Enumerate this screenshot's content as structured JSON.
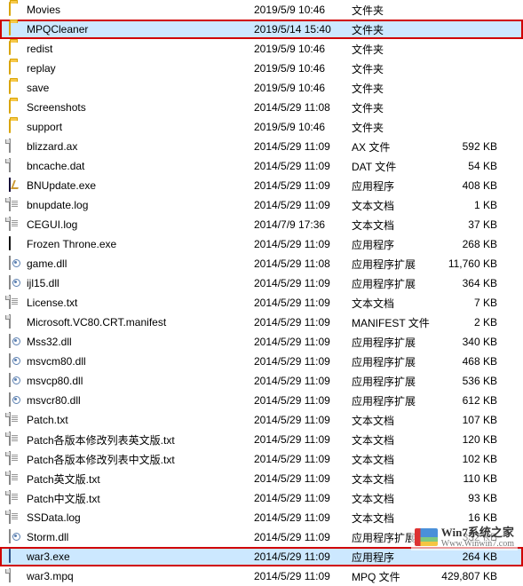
{
  "watermark": {
    "line1": "Win7系统之家",
    "line2": "Www.Winwin7.com"
  },
  "files": [
    {
      "icon": "folder",
      "name": "Movies",
      "date": "2019/5/9 10:46",
      "type": "文件夹",
      "size": ""
    },
    {
      "icon": "folder",
      "name": "MPQCleaner",
      "date": "2019/5/14 15:40",
      "type": "文件夹",
      "size": "",
      "selected": true,
      "highlight": true
    },
    {
      "icon": "folder",
      "name": "redist",
      "date": "2019/5/9 10:46",
      "type": "文件夹",
      "size": ""
    },
    {
      "icon": "folder",
      "name": "replay",
      "date": "2019/5/9 10:46",
      "type": "文件夹",
      "size": ""
    },
    {
      "icon": "folder",
      "name": "save",
      "date": "2019/5/9 10:46",
      "type": "文件夹",
      "size": ""
    },
    {
      "icon": "folder",
      "name": "Screenshots",
      "date": "2014/5/29 11:08",
      "type": "文件夹",
      "size": ""
    },
    {
      "icon": "folder",
      "name": "support",
      "date": "2019/5/9 10:46",
      "type": "文件夹",
      "size": ""
    },
    {
      "icon": "file",
      "name": "blizzard.ax",
      "date": "2014/5/29 11:09",
      "type": "AX 文件",
      "size": "592 KB"
    },
    {
      "icon": "file",
      "name": "bncache.dat",
      "date": "2014/5/29 11:09",
      "type": "DAT 文件",
      "size": "54 KB"
    },
    {
      "icon": "bnupdate",
      "name": "BNUpdate.exe",
      "date": "2014/5/29 11:09",
      "type": "应用程序",
      "size": "408 KB"
    },
    {
      "icon": "txt",
      "name": "bnupdate.log",
      "date": "2014/5/29 11:09",
      "type": "文本文档",
      "size": "1 KB"
    },
    {
      "icon": "txt",
      "name": "CEGUI.log",
      "date": "2014/7/9 17:36",
      "type": "文本文档",
      "size": "37 KB"
    },
    {
      "icon": "exe-dark",
      "name": "Frozen Throne.exe",
      "date": "2014/5/29 11:09",
      "type": "应用程序",
      "size": "268 KB"
    },
    {
      "icon": "dll",
      "name": "game.dll",
      "date": "2014/5/29 11:08",
      "type": "应用程序扩展",
      "size": "11,760 KB"
    },
    {
      "icon": "dll",
      "name": "ijl15.dll",
      "date": "2014/5/29 11:09",
      "type": "应用程序扩展",
      "size": "364 KB"
    },
    {
      "icon": "txt",
      "name": "License.txt",
      "date": "2014/5/29 11:09",
      "type": "文本文档",
      "size": "7 KB"
    },
    {
      "icon": "file",
      "name": "Microsoft.VC80.CRT.manifest",
      "date": "2014/5/29 11:09",
      "type": "MANIFEST 文件",
      "size": "2 KB"
    },
    {
      "icon": "dll",
      "name": "Mss32.dll",
      "date": "2014/5/29 11:09",
      "type": "应用程序扩展",
      "size": "340 KB"
    },
    {
      "icon": "dll",
      "name": "msvcm80.dll",
      "date": "2014/5/29 11:09",
      "type": "应用程序扩展",
      "size": "468 KB"
    },
    {
      "icon": "dll",
      "name": "msvcp80.dll",
      "date": "2014/5/29 11:09",
      "type": "应用程序扩展",
      "size": "536 KB"
    },
    {
      "icon": "dll",
      "name": "msvcr80.dll",
      "date": "2014/5/29 11:09",
      "type": "应用程序扩展",
      "size": "612 KB"
    },
    {
      "icon": "txt",
      "name": "Patch.txt",
      "date": "2014/5/29 11:09",
      "type": "文本文档",
      "size": "107 KB"
    },
    {
      "icon": "txt",
      "name": "Patch各版本修改列表英文版.txt",
      "date": "2014/5/29 11:09",
      "type": "文本文档",
      "size": "120 KB"
    },
    {
      "icon": "txt",
      "name": "Patch各版本修改列表中文版.txt",
      "date": "2014/5/29 11:09",
      "type": "文本文档",
      "size": "102 KB"
    },
    {
      "icon": "txt",
      "name": "Patch英文版.txt",
      "date": "2014/5/29 11:09",
      "type": "文本文档",
      "size": "110 KB"
    },
    {
      "icon": "txt",
      "name": "Patch中文版.txt",
      "date": "2014/5/29 11:09",
      "type": "文本文档",
      "size": "93 KB"
    },
    {
      "icon": "txt",
      "name": "SSData.log",
      "date": "2014/5/29 11:09",
      "type": "文本文档",
      "size": "16 KB"
    },
    {
      "icon": "dll",
      "name": "Storm.dll",
      "date": "2014/5/29 11:09",
      "type": "应用程序扩展",
      "size": "332 KB"
    },
    {
      "icon": "exe",
      "name": "war3.exe",
      "date": "2014/5/29 11:09",
      "type": "应用程序",
      "size": "264 KB",
      "selected": true,
      "highlight": true
    },
    {
      "icon": "file",
      "name": "war3.mpq",
      "date": "2014/5/29 11:09",
      "type": "MPQ 文件",
      "size": "429,807 KB"
    }
  ]
}
